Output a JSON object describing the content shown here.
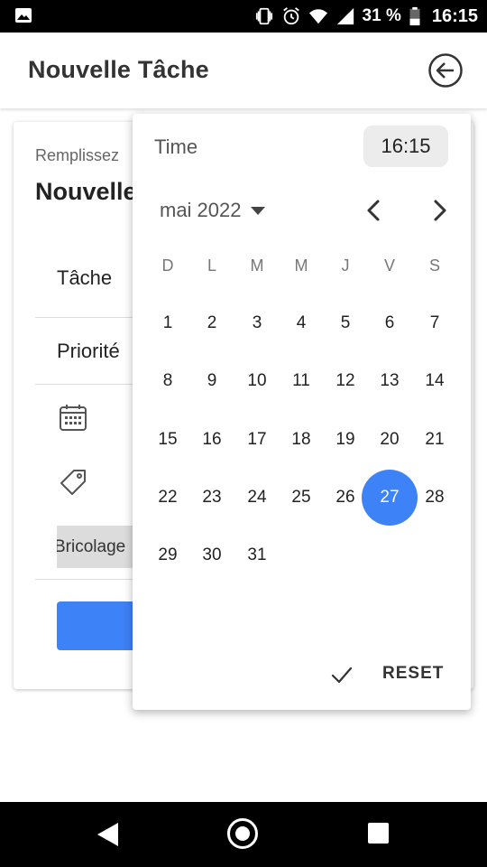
{
  "status_bar": {
    "battery_percent": "31 %",
    "time": "16:15",
    "icons": [
      "image-icon",
      "vibrate-icon",
      "alarm-icon",
      "wifi-icon",
      "signal-icon",
      "battery-icon"
    ]
  },
  "app_bar": {
    "title": "Nouvelle Tâche",
    "back_icon": "arrow-left-circle-icon"
  },
  "card": {
    "subtitle": "Remplissez",
    "title": "Nouvelle",
    "fields": [
      "Tâche",
      "Priorité"
    ],
    "chip_label": "Bricolage",
    "calendar_icon": "calendar-icon",
    "tag_icon": "tag-icon"
  },
  "picker": {
    "time_label": "Time",
    "time_value": "16:15",
    "month": "mai 2022",
    "weekdays": [
      "D",
      "L",
      "M",
      "M",
      "J",
      "V",
      "S"
    ],
    "weeks": [
      [
        "1",
        "2",
        "3",
        "4",
        "5",
        "6",
        "7"
      ],
      [
        "8",
        "9",
        "10",
        "11",
        "12",
        "13",
        "14"
      ],
      [
        "15",
        "16",
        "17",
        "18",
        "19",
        "20",
        "21"
      ],
      [
        "22",
        "23",
        "24",
        "25",
        "26",
        "27",
        "28"
      ],
      [
        "29",
        "30",
        "31"
      ]
    ],
    "selected_day": "27",
    "reset_label": "RESET",
    "accent_color": "#3e82f7"
  }
}
